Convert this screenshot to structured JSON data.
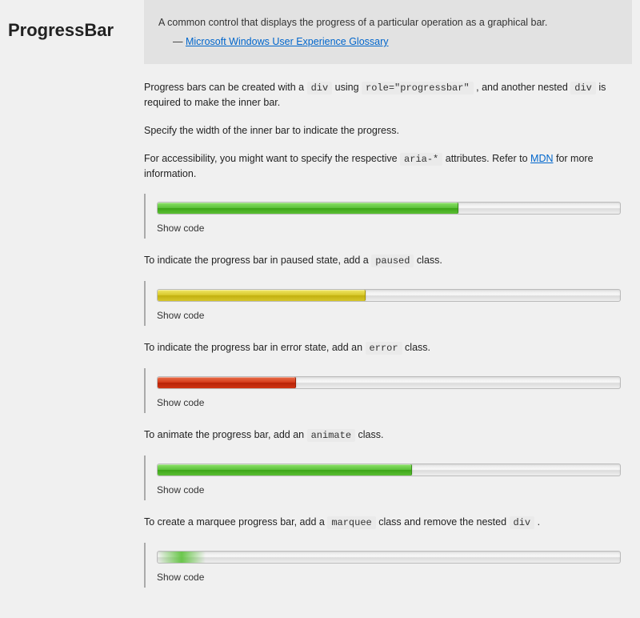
{
  "title": "ProgressBar",
  "quote": {
    "text": "A common control that displays the progress of a particular operation as a graphical bar.",
    "dash": "— ",
    "source_label": "Microsoft Windows User Experience Glossary"
  },
  "intro": {
    "p1_pre": "Progress bars can be created with a ",
    "p1_code1": "div",
    "p1_mid1": " using ",
    "p1_code2": "role=\"progressbar\"",
    "p1_mid2": " , and another nested ",
    "p1_code3": "div",
    "p1_post": " is required to make the inner bar.",
    "p2": "Specify the width of the inner bar to indicate the progress.",
    "p3_pre": "For accessibility, you might want to specify the respective ",
    "p3_code": "aria-*",
    "p3_mid": " attributes. Refer to ",
    "p3_link": "MDN",
    "p3_post": " for more information."
  },
  "examples": [
    {
      "desc_pre": "",
      "desc_code": "",
      "desc_post": "",
      "fill_class": "fill-green",
      "width": "65%"
    },
    {
      "desc_pre": "To indicate the progress bar in paused state, add a ",
      "desc_code": "paused",
      "desc_post": " class.",
      "fill_class": "fill-yellow",
      "width": "45%"
    },
    {
      "desc_pre": "To indicate the progress bar in error state, add an ",
      "desc_code": "error",
      "desc_post": " class.",
      "fill_class": "fill-red",
      "width": "30%"
    },
    {
      "desc_pre": "To animate the progress bar, add an ",
      "desc_code": "animate",
      "desc_post": " class.",
      "fill_class": "fill-green",
      "width": "55%"
    },
    {
      "desc_pre": "To create a marquee progress bar, add a ",
      "desc_code": "marquee",
      "desc_mid": " class and remove the nested ",
      "desc_code2": "div",
      "desc_post": " .",
      "fill_class": "marquee",
      "width": ""
    }
  ],
  "show_code_label": "Show code"
}
